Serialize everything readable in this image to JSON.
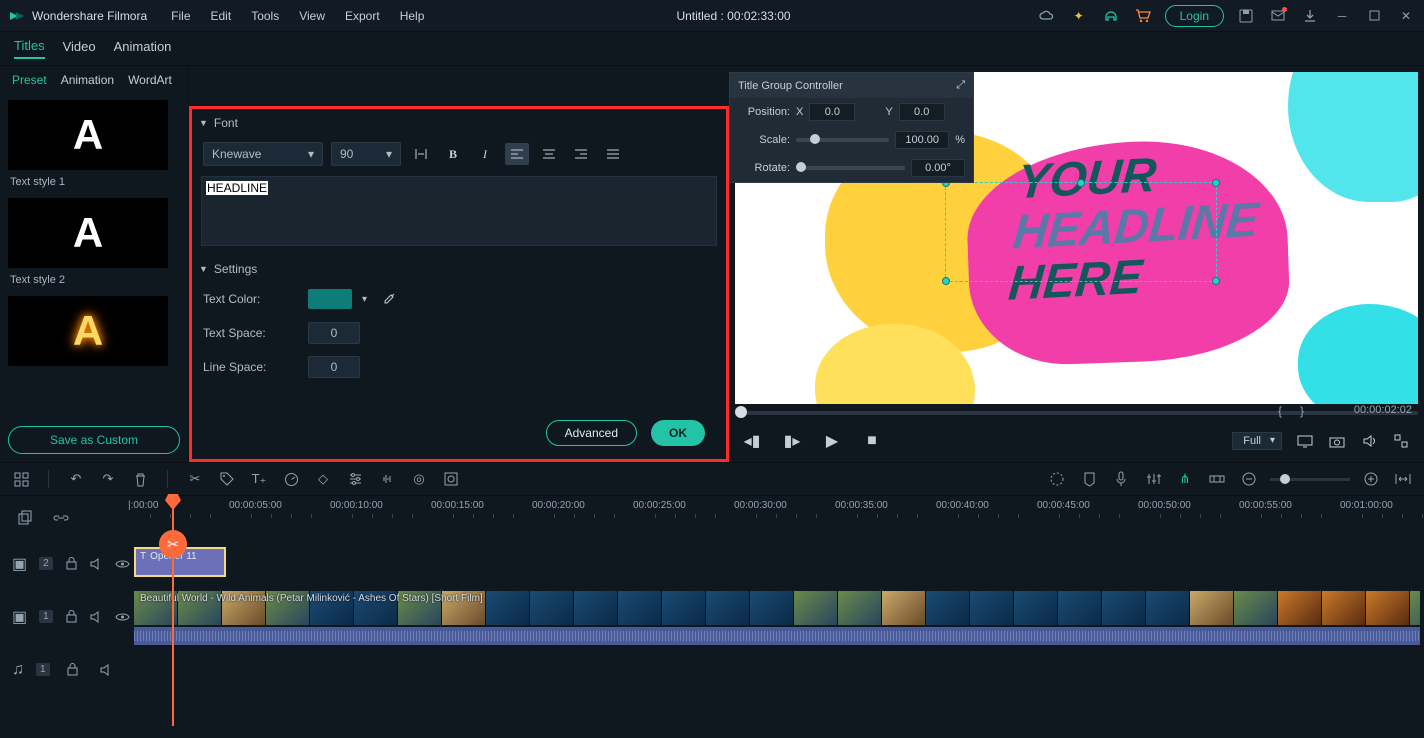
{
  "title_bar": {
    "app_name": "Wondershare Filmora",
    "menus": [
      "File",
      "Edit",
      "Tools",
      "View",
      "Export",
      "Help"
    ],
    "center_title": "Untitled : 00:02:33:00",
    "login_label": "Login"
  },
  "sec_tabs": {
    "items": [
      "Titles",
      "Video",
      "Animation"
    ],
    "active": 0
  },
  "sub_tabs": {
    "items": [
      "Preset",
      "Animation",
      "WordArt"
    ],
    "active": 0
  },
  "presets": [
    {
      "glyph": "A",
      "label": "Text style 1"
    },
    {
      "glyph": "A",
      "label": "Text style 2"
    },
    {
      "glyph": "A",
      "label": ""
    }
  ],
  "save_custom_label": "Save as Custom",
  "editor": {
    "section_font": "Font",
    "font_name": "Knewave",
    "font_size": "90",
    "text_content": "HEADLINE",
    "section_settings": "Settings",
    "text_color_label": "Text Color:",
    "text_space_label": "Text Space:",
    "text_space_value": "0",
    "line_space_label": "Line Space:",
    "line_space_value": "0",
    "advanced_label": "Advanced",
    "ok_label": "OK"
  },
  "controller": {
    "title": "Title Group Controller",
    "position_label": "Position:",
    "x_label": "X",
    "x_value": "0.0",
    "y_label": "Y",
    "y_value": "0.0",
    "scale_label": "Scale:",
    "scale_value": "100.00",
    "scale_unit": "%",
    "rotate_label": "Rotate:",
    "rotate_value": "0.00°"
  },
  "preview": {
    "headline_lines": [
      "YOUR",
      "HEADLINE",
      "HERE"
    ],
    "current_time": "00:00:02:02",
    "quality": "Full"
  },
  "ruler_labels": [
    "|:00:00",
    "00:00:05:00",
    "00:00:10:00",
    "00:00:15:00",
    "00:00:20:00",
    "00:00:25:00",
    "00:00:30:00",
    "00:00:35:00",
    "00:00:40:00",
    "00:00:45:00",
    "00:00:50:00",
    "00:00:55:00",
    "00:01:00:00"
  ],
  "tracks": {
    "t1_badge": "2",
    "title_clip": "Opener 11",
    "t2_badge": "1",
    "video_clip": "Beautiful World - Wild Animals (Petar Milinković - Ashes Of Stars) [Short Film]",
    "t3_badge": "1"
  }
}
